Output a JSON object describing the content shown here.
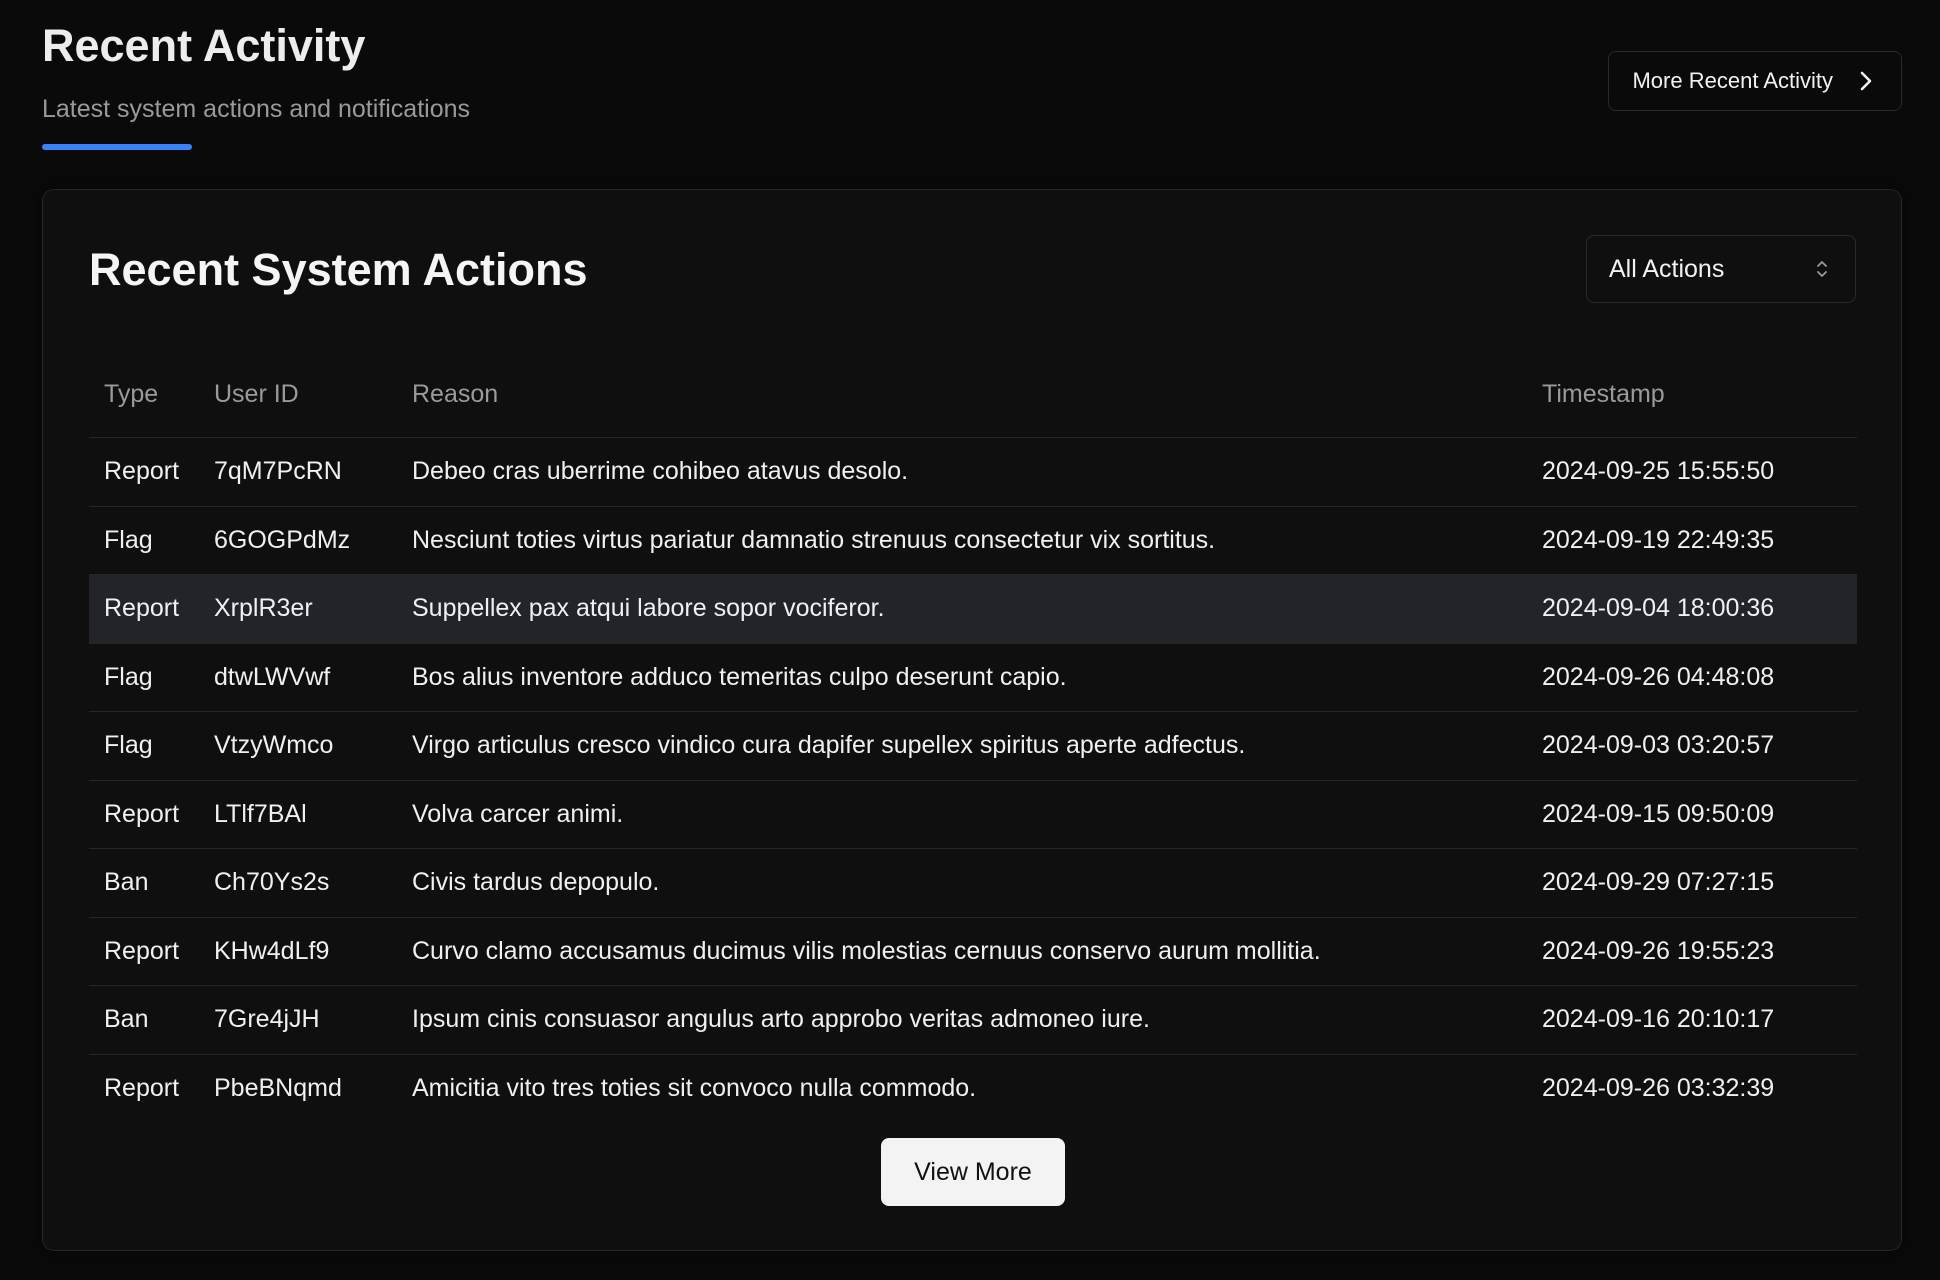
{
  "header": {
    "title": "Recent Activity",
    "subtitle": "Latest system actions and notifications",
    "more_button": "More Recent Activity"
  },
  "card": {
    "title": "Recent System Actions",
    "filter": {
      "selected": "All Actions"
    },
    "view_more": "View More"
  },
  "table": {
    "columns": [
      "Type",
      "User ID",
      "Reason",
      "Timestamp"
    ],
    "rows": [
      {
        "type": "Report",
        "user_id": "7qM7PcRN",
        "reason": "Debeo cras uberrime cohibeo atavus desolo.",
        "timestamp": "2024-09-25 15:55:50"
      },
      {
        "type": "Flag",
        "user_id": "6GOGPdMz",
        "reason": "Nesciunt toties virtus pariatur damnatio strenuus consectetur vix sortitus.",
        "timestamp": "2024-09-19 22:49:35"
      },
      {
        "type": "Report",
        "user_id": "XrplR3er",
        "reason": "Suppellex pax atqui labore sopor vociferor.",
        "timestamp": "2024-09-04 18:00:36"
      },
      {
        "type": "Flag",
        "user_id": "dtwLWVwf",
        "reason": "Bos alius inventore adduco temeritas culpo deserunt capio.",
        "timestamp": "2024-09-26 04:48:08"
      },
      {
        "type": "Flag",
        "user_id": "VtzyWmco",
        "reason": "Virgo articulus cresco vindico cura dapifer supellex spiritus aperte adfectus.",
        "timestamp": "2024-09-03 03:20:57"
      },
      {
        "type": "Report",
        "user_id": "LTlf7BAl",
        "reason": "Volva carcer animi.",
        "timestamp": "2024-09-15 09:50:09"
      },
      {
        "type": "Ban",
        "user_id": "Ch70Ys2s",
        "reason": "Civis tardus depopulo.",
        "timestamp": "2024-09-29 07:27:15"
      },
      {
        "type": "Report",
        "user_id": "KHw4dLf9",
        "reason": "Curvo clamo accusamus ducimus vilis molestias cernuus conservo aurum mollitia.",
        "timestamp": "2024-09-26 19:55:23"
      },
      {
        "type": "Ban",
        "user_id": "7Gre4jJH",
        "reason": "Ipsum cinis consuasor angulus arto approbo veritas admoneo iure.",
        "timestamp": "2024-09-16 20:10:17"
      },
      {
        "type": "Report",
        "user_id": "PbeBNqmd",
        "reason": "Amicitia vito tres toties sit convoco nulla commodo.",
        "timestamp": "2024-09-26 03:32:39"
      }
    ]
  },
  "icons": {
    "more_button": "chevron-right-icon",
    "filter": "chevron-up-down-icon"
  },
  "colors": {
    "accent": "#3b82f6",
    "background": "#0a0a0a",
    "highlight_row": "#22242a"
  }
}
